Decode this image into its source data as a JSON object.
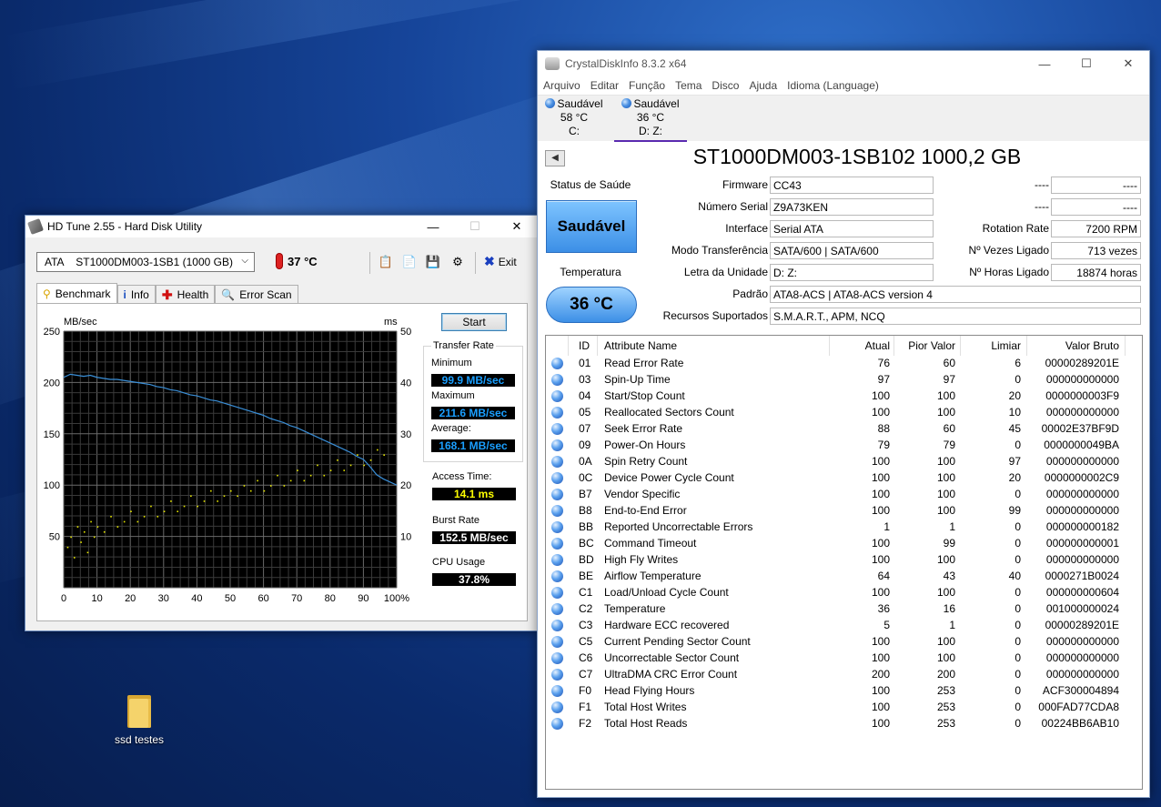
{
  "hdtune": {
    "title": "HD Tune 2.55 - Hard Disk Utility",
    "drive": "ATA    ST1000DM003-1SB1 (1000 GB)",
    "temperature": "37 °C",
    "exit_label": "Exit",
    "tabs": [
      {
        "label": "Benchmark",
        "icon": "lightbulb-icon"
      },
      {
        "label": "Info",
        "icon": "info-icon"
      },
      {
        "label": "Health",
        "icon": "health-cross-icon"
      },
      {
        "label": "Error Scan",
        "icon": "magnifier-icon"
      }
    ],
    "start_label": "Start",
    "transfer_rate_title": "Transfer Rate",
    "minimum_label": "Minimum",
    "minimum_value": "99.9 MB/sec",
    "maximum_label": "Maximum",
    "maximum_value": "211.6 MB/sec",
    "average_label": "Average:",
    "average_value": "168.1 MB/sec",
    "access_label": "Access Time:",
    "access_value": "14.1 ms",
    "burst_label": "Burst Rate",
    "burst_value": "152.5 MB/sec",
    "cpu_label": "CPU Usage",
    "cpu_value": "37.8%"
  },
  "chart_data": {
    "type": "line",
    "ylabel": "MB/sec",
    "y2label": "ms",
    "xlim": [
      0,
      100
    ],
    "ylim": [
      0,
      250
    ],
    "y2lim": [
      0,
      50
    ],
    "x_ticks": [
      "0",
      "10",
      "20",
      "30",
      "40",
      "50",
      "60",
      "70",
      "80",
      "90",
      "100%"
    ],
    "y_ticks": [
      "50",
      "100",
      "150",
      "200",
      "250"
    ],
    "y2_ticks": [
      "10",
      "20",
      "30",
      "40",
      "50"
    ],
    "grid": true,
    "series": [
      {
        "color": "#3a8fd8",
        "x": [
          0,
          2,
          4,
          6,
          8,
          10,
          12,
          14,
          16,
          18,
          20,
          22,
          24,
          26,
          28,
          30,
          32,
          34,
          36,
          38,
          40,
          42,
          44,
          46,
          48,
          50,
          52,
          54,
          56,
          58,
          60,
          62,
          64,
          66,
          68,
          70,
          72,
          74,
          76,
          78,
          80,
          82,
          84,
          86,
          88,
          90,
          92,
          94,
          96,
          98,
          100
        ],
        "y": [
          205,
          208,
          207,
          206,
          207,
          205,
          204,
          203,
          203,
          202,
          201,
          200,
          199,
          198,
          196,
          195,
          193,
          192,
          190,
          188,
          187,
          185,
          183,
          182,
          180,
          178,
          176,
          174,
          172,
          170,
          168,
          165,
          163,
          161,
          158,
          156,
          153,
          150,
          147,
          144,
          141,
          138,
          135,
          132,
          128,
          125,
          118,
          110,
          106,
          103,
          100
        ]
      },
      {
        "color": "#e6e600",
        "x": [
          1,
          2,
          3,
          4,
          5,
          6,
          7,
          8,
          9,
          10,
          12,
          14,
          16,
          18,
          20,
          22,
          24,
          26,
          28,
          30,
          32,
          34,
          36,
          38,
          40,
          42,
          44,
          46,
          48,
          50,
          52,
          54,
          56,
          58,
          60,
          62,
          64,
          66,
          68,
          70,
          72,
          74,
          76,
          78,
          80,
          82,
          84,
          86,
          88,
          90,
          92,
          94,
          96
        ],
        "y": [
          8,
          10,
          6,
          12,
          9,
          11,
          7,
          13,
          10,
          12,
          11,
          14,
          12,
          13,
          15,
          13,
          14,
          16,
          14,
          15,
          17,
          15,
          16,
          18,
          16,
          17,
          19,
          17,
          18,
          19,
          18,
          20,
          19,
          21,
          19,
          20,
          22,
          20,
          21,
          23,
          21,
          22,
          24,
          22,
          23,
          25,
          23,
          24,
          26,
          24,
          25,
          27,
          26
        ]
      }
    ]
  },
  "desktop": {
    "folder_label": "ssd testes"
  },
  "cdi": {
    "title": "CrystalDiskInfo 8.3.2 x64",
    "menu": [
      "Arquivo",
      "Editar",
      "Função",
      "Tema",
      "Disco",
      "Ajuda",
      "Idioma (Language)"
    ],
    "disks": [
      {
        "status": "Saudável",
        "temp": "58 °C",
        "letter": "C:"
      },
      {
        "status": "Saudável",
        "temp": "36 °C",
        "letter": "D: Z:"
      }
    ],
    "model": "ST1000DM003-1SB102 1000,2 GB",
    "health_label": "Status de Saúde",
    "health_value": "Saudável",
    "temp_label": "Temperatura",
    "temp_value": "36 °C",
    "fields": {
      "firmware_label": "Firmware",
      "firmware": "CC43",
      "serial_label": "Número Serial",
      "serial": "Z9A73KEN",
      "interface_label": "Interface",
      "interface": "Serial ATA",
      "transfer_label": "Modo Transferência",
      "transfer": "SATA/600 | SATA/600",
      "letter_label": "Letra da Unidade",
      "letter": "D: Z:",
      "standard_label": "Padrão",
      "standard": "ATA8-ACS | ATA8-ACS version 4",
      "features_label": "Recursos Suportados",
      "features": "S.M.A.R.T., APM, NCQ",
      "blank1_label": "----",
      "blank1": "----",
      "blank2_label": "----",
      "blank2": "----",
      "rotation_label": "Rotation Rate",
      "rotation": "7200 RPM",
      "poweron_count_label": "Nº Vezes Ligado",
      "poweron_count": "713 vezes",
      "poweron_hours_label": "Nº Horas Ligado",
      "poweron_hours": "18874 horas"
    },
    "smart_headers": {
      "id": "ID",
      "name": "Attribute Name",
      "current": "Atual",
      "worst": "Pior Valor",
      "threshold": "Limiar",
      "raw": "Valor Bruto"
    },
    "smart": [
      {
        "id": "01",
        "name": "Read Error Rate",
        "cur": "76",
        "worst": "60",
        "thr": "6",
        "raw": "00000289201E"
      },
      {
        "id": "03",
        "name": "Spin-Up Time",
        "cur": "97",
        "worst": "97",
        "thr": "0",
        "raw": "000000000000"
      },
      {
        "id": "04",
        "name": "Start/Stop Count",
        "cur": "100",
        "worst": "100",
        "thr": "20",
        "raw": "0000000003F9"
      },
      {
        "id": "05",
        "name": "Reallocated Sectors Count",
        "cur": "100",
        "worst": "100",
        "thr": "10",
        "raw": "000000000000"
      },
      {
        "id": "07",
        "name": "Seek Error Rate",
        "cur": "88",
        "worst": "60",
        "thr": "45",
        "raw": "00002E37BF9D"
      },
      {
        "id": "09",
        "name": "Power-On Hours",
        "cur": "79",
        "worst": "79",
        "thr": "0",
        "raw": "0000000049BA"
      },
      {
        "id": "0A",
        "name": "Spin Retry Count",
        "cur": "100",
        "worst": "100",
        "thr": "97",
        "raw": "000000000000"
      },
      {
        "id": "0C",
        "name": "Device Power Cycle Count",
        "cur": "100",
        "worst": "100",
        "thr": "20",
        "raw": "0000000002C9"
      },
      {
        "id": "B7",
        "name": "Vendor Specific",
        "cur": "100",
        "worst": "100",
        "thr": "0",
        "raw": "000000000000"
      },
      {
        "id": "B8",
        "name": "End-to-End Error",
        "cur": "100",
        "worst": "100",
        "thr": "99",
        "raw": "000000000000"
      },
      {
        "id": "BB",
        "name": "Reported Uncorrectable Errors",
        "cur": "1",
        "worst": "1",
        "thr": "0",
        "raw": "000000000182"
      },
      {
        "id": "BC",
        "name": "Command Timeout",
        "cur": "100",
        "worst": "99",
        "thr": "0",
        "raw": "000000000001"
      },
      {
        "id": "BD",
        "name": "High Fly Writes",
        "cur": "100",
        "worst": "100",
        "thr": "0",
        "raw": "000000000000"
      },
      {
        "id": "BE",
        "name": "Airflow Temperature",
        "cur": "64",
        "worst": "43",
        "thr": "40",
        "raw": "0000271B0024"
      },
      {
        "id": "C1",
        "name": "Load/Unload Cycle Count",
        "cur": "100",
        "worst": "100",
        "thr": "0",
        "raw": "000000000604"
      },
      {
        "id": "C2",
        "name": "Temperature",
        "cur": "36",
        "worst": "16",
        "thr": "0",
        "raw": "001000000024"
      },
      {
        "id": "C3",
        "name": "Hardware ECC recovered",
        "cur": "5",
        "worst": "1",
        "thr": "0",
        "raw": "00000289201E"
      },
      {
        "id": "C5",
        "name": "Current Pending Sector Count",
        "cur": "100",
        "worst": "100",
        "thr": "0",
        "raw": "000000000000"
      },
      {
        "id": "C6",
        "name": "Uncorrectable Sector Count",
        "cur": "100",
        "worst": "100",
        "thr": "0",
        "raw": "000000000000"
      },
      {
        "id": "C7",
        "name": "UltraDMA CRC Error Count",
        "cur": "200",
        "worst": "200",
        "thr": "0",
        "raw": "000000000000"
      },
      {
        "id": "F0",
        "name": "Head Flying Hours",
        "cur": "100",
        "worst": "253",
        "thr": "0",
        "raw": "ACF300004894"
      },
      {
        "id": "F1",
        "name": "Total Host Writes",
        "cur": "100",
        "worst": "253",
        "thr": "0",
        "raw": "000FAD77CDA8"
      },
      {
        "id": "F2",
        "name": "Total Host Reads",
        "cur": "100",
        "worst": "253",
        "thr": "0",
        "raw": "00224BB6AB10"
      }
    ]
  }
}
